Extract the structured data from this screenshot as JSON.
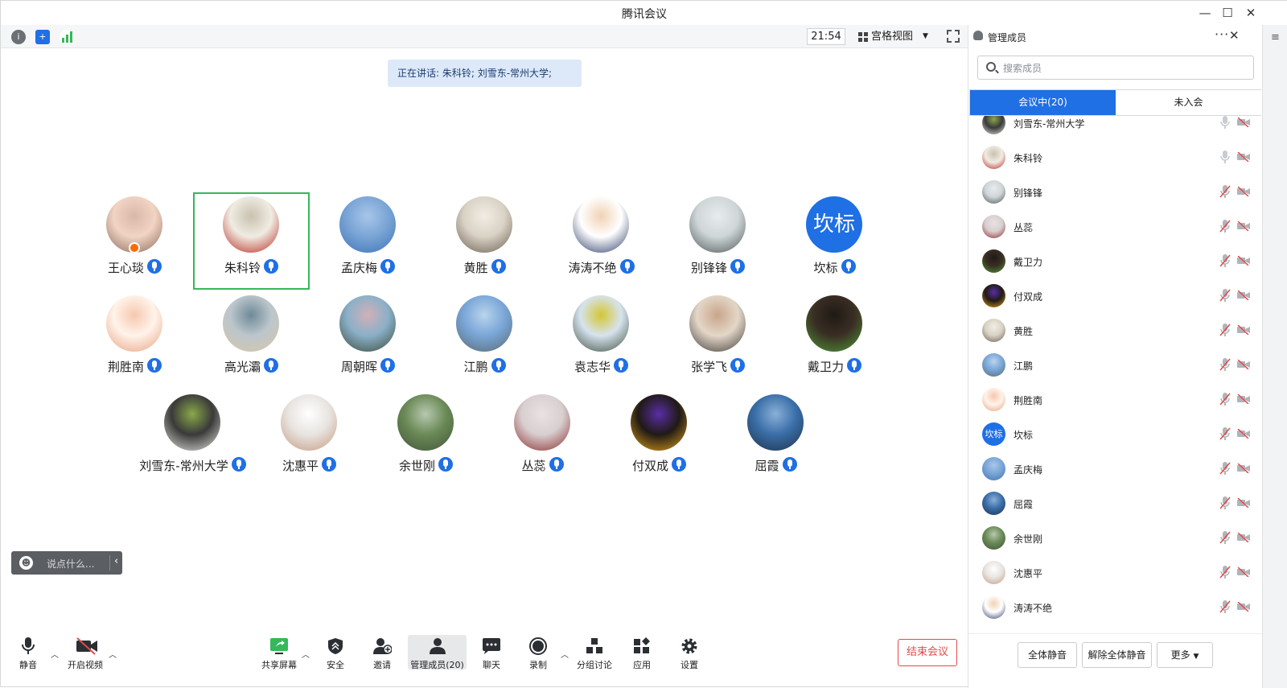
{
  "window": {
    "title": "腾讯会议"
  },
  "topbar": {
    "time": "21:54",
    "view_label": "宫格视图"
  },
  "speaking": {
    "text": "正在讲话: 朱科铃; 刘雪东-常州大学;"
  },
  "participants": [
    {
      "name": "王心琰",
      "colors": [
        "#f2d4c4",
        "#8a6a5a",
        "#d9b8a8"
      ]
    },
    {
      "name": "朱科铃",
      "colors": [
        "#f0ece2",
        "#b6281f",
        "#c9c1b0"
      ]
    },
    {
      "name": "孟庆梅",
      "colors": [
        "#7aa5d6",
        "#3d74b6",
        "#a8c6e8"
      ]
    },
    {
      "name": "黄胜",
      "colors": [
        "#d9d2c5",
        "#6a5e50",
        "#f2ede4"
      ]
    },
    {
      "name": "涛涛不绝",
      "colors": [
        "#ffffff",
        "#2a3a66",
        "#f1d2b4"
      ]
    },
    {
      "name": "别锋锋",
      "colors": [
        "#cfd6d8",
        "#4d5656",
        "#e7ecee"
      ]
    },
    {
      "name": "坎标",
      "colors": [
        "#1f6fe5",
        "#1f6fe5",
        "#1f6fe5"
      ],
      "text_avatar": "坎标"
    },
    {
      "name": "荆胜南",
      "colors": [
        "#fff3ea",
        "#e7a27f",
        "#f6c8b0"
      ]
    },
    {
      "name": "高光灞",
      "colors": [
        "#bcc6cc",
        "#d8c7a8",
        "#6e8a98"
      ]
    },
    {
      "name": "周朝晖",
      "colors": [
        "#8ab0c8",
        "#3a4a38",
        "#d2b0b8"
      ]
    },
    {
      "name": "江鹏",
      "colors": [
        "#7aa6d8",
        "#5a6a70",
        "#bad4ec"
      ]
    },
    {
      "name": "袁志华",
      "colors": [
        "#d6e3ef",
        "#3c4c3a",
        "#d4c633"
      ]
    },
    {
      "name": "张学飞",
      "colors": [
        "#e3d7c8",
        "#3f3a35",
        "#c9a58a"
      ]
    },
    {
      "name": "戴卫力",
      "colors": [
        "#3a2e24",
        "#4e9a36",
        "#1f1a14"
      ]
    },
    {
      "name": "刘雪东-常州大学",
      "colors": [
        "#3a3a3a",
        "#e6e6e0",
        "#8aa84a"
      ]
    },
    {
      "name": "沈惠平",
      "colors": [
        "#e8e4e0",
        "#c49a82",
        "#ffffff"
      ]
    },
    {
      "name": "余世刚",
      "colors": [
        "#6a8a56",
        "#43533c",
        "#b8c8b0"
      ]
    },
    {
      "name": "丛蕊",
      "colors": [
        "#d8cfd0",
        "#8a2a2a",
        "#eae2e2"
      ]
    },
    {
      "name": "付双成",
      "colors": [
        "#201a16",
        "#e3a21a",
        "#5a2ea6"
      ]
    },
    {
      "name": "屈霞",
      "colors": [
        "#3a6ea8",
        "#1f3248",
        "#8ab0d8"
      ]
    }
  ],
  "chat": {
    "placeholder": "说点什么..."
  },
  "bottombar": {
    "mute": "静音",
    "video": "开启视频",
    "share": "共享屏幕",
    "security": "安全",
    "invite": "邀请",
    "members": "管理成员(20)",
    "chat": "聊天",
    "record": "录制",
    "breakout": "分组讨论",
    "apps": "应用",
    "settings": "设置",
    "end": "结束会议"
  },
  "panel": {
    "title": "管理成员",
    "search_placeholder": "搜索成员",
    "tab_in": "会议中(20)",
    "tab_out": "未入会",
    "members": [
      {
        "name": "刘雪东-常州大学",
        "colors": [
          "#3a3a3a",
          "#e6e6e0",
          "#8aa84a"
        ],
        "muted": false
      },
      {
        "name": "朱科铃",
        "colors": [
          "#f0ece2",
          "#b6281f",
          "#c9c1b0"
        ],
        "muted": false
      },
      {
        "name": "别锋锋",
        "colors": [
          "#cfd6d8",
          "#4d5656",
          "#e7ecee"
        ],
        "muted": true
      },
      {
        "name": "丛蕊",
        "colors": [
          "#d8cfd0",
          "#8a2a2a",
          "#eae2e2"
        ],
        "muted": true
      },
      {
        "name": "戴卫力",
        "colors": [
          "#3a2e24",
          "#4e9a36",
          "#1f1a14"
        ],
        "muted": true
      },
      {
        "name": "付双成",
        "colors": [
          "#201a16",
          "#e3a21a",
          "#5a2ea6"
        ],
        "muted": true
      },
      {
        "name": "黄胜",
        "colors": [
          "#d9d2c5",
          "#6a5e50",
          "#f2ede4"
        ],
        "muted": true
      },
      {
        "name": "江鹏",
        "colors": [
          "#7aa6d8",
          "#5a6a70",
          "#bad4ec"
        ],
        "muted": true
      },
      {
        "name": "荆胜南",
        "colors": [
          "#fff3ea",
          "#e7a27f",
          "#f6c8b0"
        ],
        "muted": true
      },
      {
        "name": "坎标",
        "colors": [
          "#1f6fe5",
          "#1f6fe5",
          "#1f6fe5"
        ],
        "text_avatar": "坎标",
        "muted": true
      },
      {
        "name": "孟庆梅",
        "colors": [
          "#7aa5d6",
          "#3d74b6",
          "#a8c6e8"
        ],
        "muted": true
      },
      {
        "name": "屈霞",
        "colors": [
          "#3a6ea8",
          "#1f3248",
          "#8ab0d8"
        ],
        "muted": true
      },
      {
        "name": "余世刚",
        "colors": [
          "#6a8a56",
          "#43533c",
          "#b8c8b0"
        ],
        "muted": true
      },
      {
        "name": "沈惠平",
        "colors": [
          "#e8e4e0",
          "#c49a82",
          "#ffffff"
        ],
        "muted": true
      },
      {
        "name": "涛涛不绝",
        "colors": [
          "#ffffff",
          "#2a3a66",
          "#f1d2b4"
        ],
        "muted": true
      }
    ],
    "mute_all": "全体静音",
    "unmute_all": "解除全体静音",
    "more": "更多"
  }
}
